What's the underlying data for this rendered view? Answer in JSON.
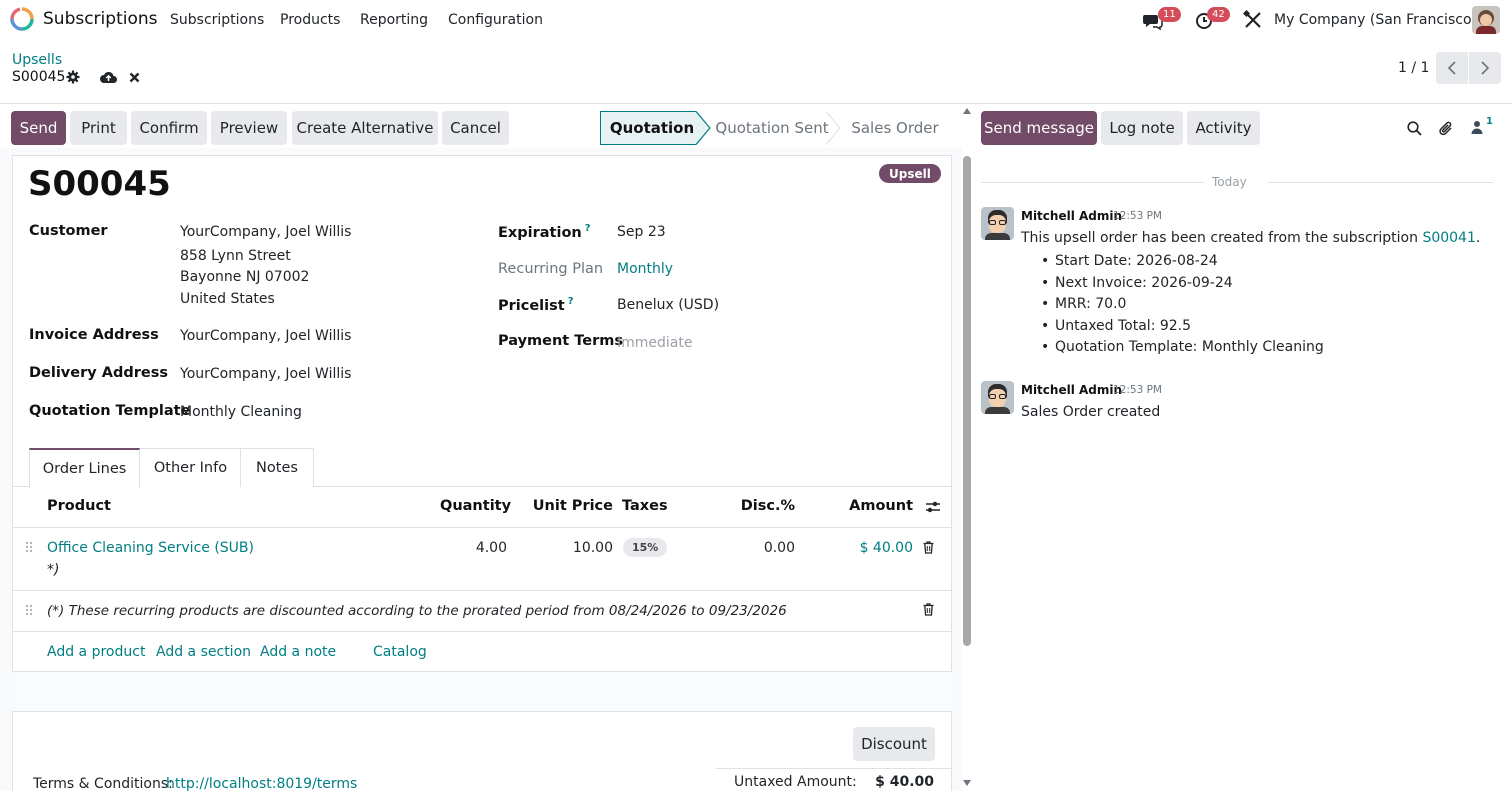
{
  "navbar": {
    "app_name": "Subscriptions",
    "menu": [
      "Subscriptions",
      "Products",
      "Reporting",
      "Configuration"
    ],
    "messages_count": "11",
    "activities_count": "42",
    "company": "My Company (San Francisco)"
  },
  "control_panel": {
    "breadcrumb": "Upsells",
    "record": "S00045",
    "pager": "1 / 1"
  },
  "actions": {
    "send": "Send",
    "print": "Print",
    "confirm": "Confirm",
    "preview": "Preview",
    "create_alternative": "Create Alternative",
    "cancel": "Cancel"
  },
  "statusbar": {
    "stages": [
      "Quotation",
      "Quotation Sent",
      "Sales Order"
    ],
    "active": "Quotation"
  },
  "form": {
    "title": "S00045",
    "ribbon": "Upsell",
    "customer_label": "Customer",
    "customer_lines": [
      "YourCompany, Joel Willis",
      "858 Lynn Street",
      "Bayonne NJ 07002",
      "United States"
    ],
    "invoice_label": "Invoice Address",
    "invoice_value": "YourCompany, Joel Willis",
    "delivery_label": "Delivery Address",
    "delivery_value": "YourCompany, Joel Willis",
    "template_label": "Quotation Template",
    "template_value": "Monthly Cleaning",
    "expiration_label": "Expiration",
    "expiration_value": "Sep 23",
    "recurring_label": "Recurring Plan",
    "recurring_value": "Monthly",
    "pricelist_label": "Pricelist",
    "pricelist_value": "Benelux (USD)",
    "payment_label": "Payment Terms",
    "payment_placeholder": "Immediate",
    "help_mark": "?"
  },
  "tabs": [
    "Order Lines",
    "Other Info",
    "Notes"
  ],
  "table": {
    "headers": {
      "product": "Product",
      "quantity": "Quantity",
      "unit_price": "Unit Price",
      "taxes": "Taxes",
      "disc": "Disc.%",
      "amount": "Amount"
    },
    "row": {
      "product": "Office Cleaning Service (SUB)",
      "product_suffix": "*)",
      "quantity": "4.00",
      "unit_price": "10.00",
      "tax": "15%",
      "disc": "0.00",
      "amount": "$ 40.00"
    },
    "note": "(*) These recurring products are discounted according to the prorated period from 08/24/2026 to 09/23/2026",
    "add_product": "Add a product",
    "add_section": "Add a section",
    "add_note": "Add a note",
    "catalog": "Catalog"
  },
  "footer": {
    "discount": "Discount",
    "terms_label": "Terms & Conditions:",
    "terms_link": "http://localhost:8019/terms",
    "untaxed_label": "Untaxed Amount:",
    "untaxed_value": "$ 40.00"
  },
  "chatter": {
    "send_message": "Send message",
    "log_note": "Log note",
    "activity": "Activity",
    "followers": "1",
    "today": "Today",
    "messages": [
      {
        "author": "Mitchell Admin",
        "time": "12:53 PM",
        "text": "This upsell order has been created from the subscription",
        "link": "S00041",
        "link_suffix": ".",
        "bullets": [
          "Start Date: 2026-08-24",
          "Next Invoice: 2026-09-24",
          "MRR: 70.0",
          "Untaxed Total: 92.5",
          "Quotation Template: Monthly Cleaning"
        ]
      },
      {
        "author": "Mitchell Admin",
        "time": "12:53 PM",
        "text": "Sales Order created"
      }
    ]
  },
  "colors": {
    "primary": "#714b67",
    "link": "#017e84",
    "badge": "#d44c59"
  }
}
